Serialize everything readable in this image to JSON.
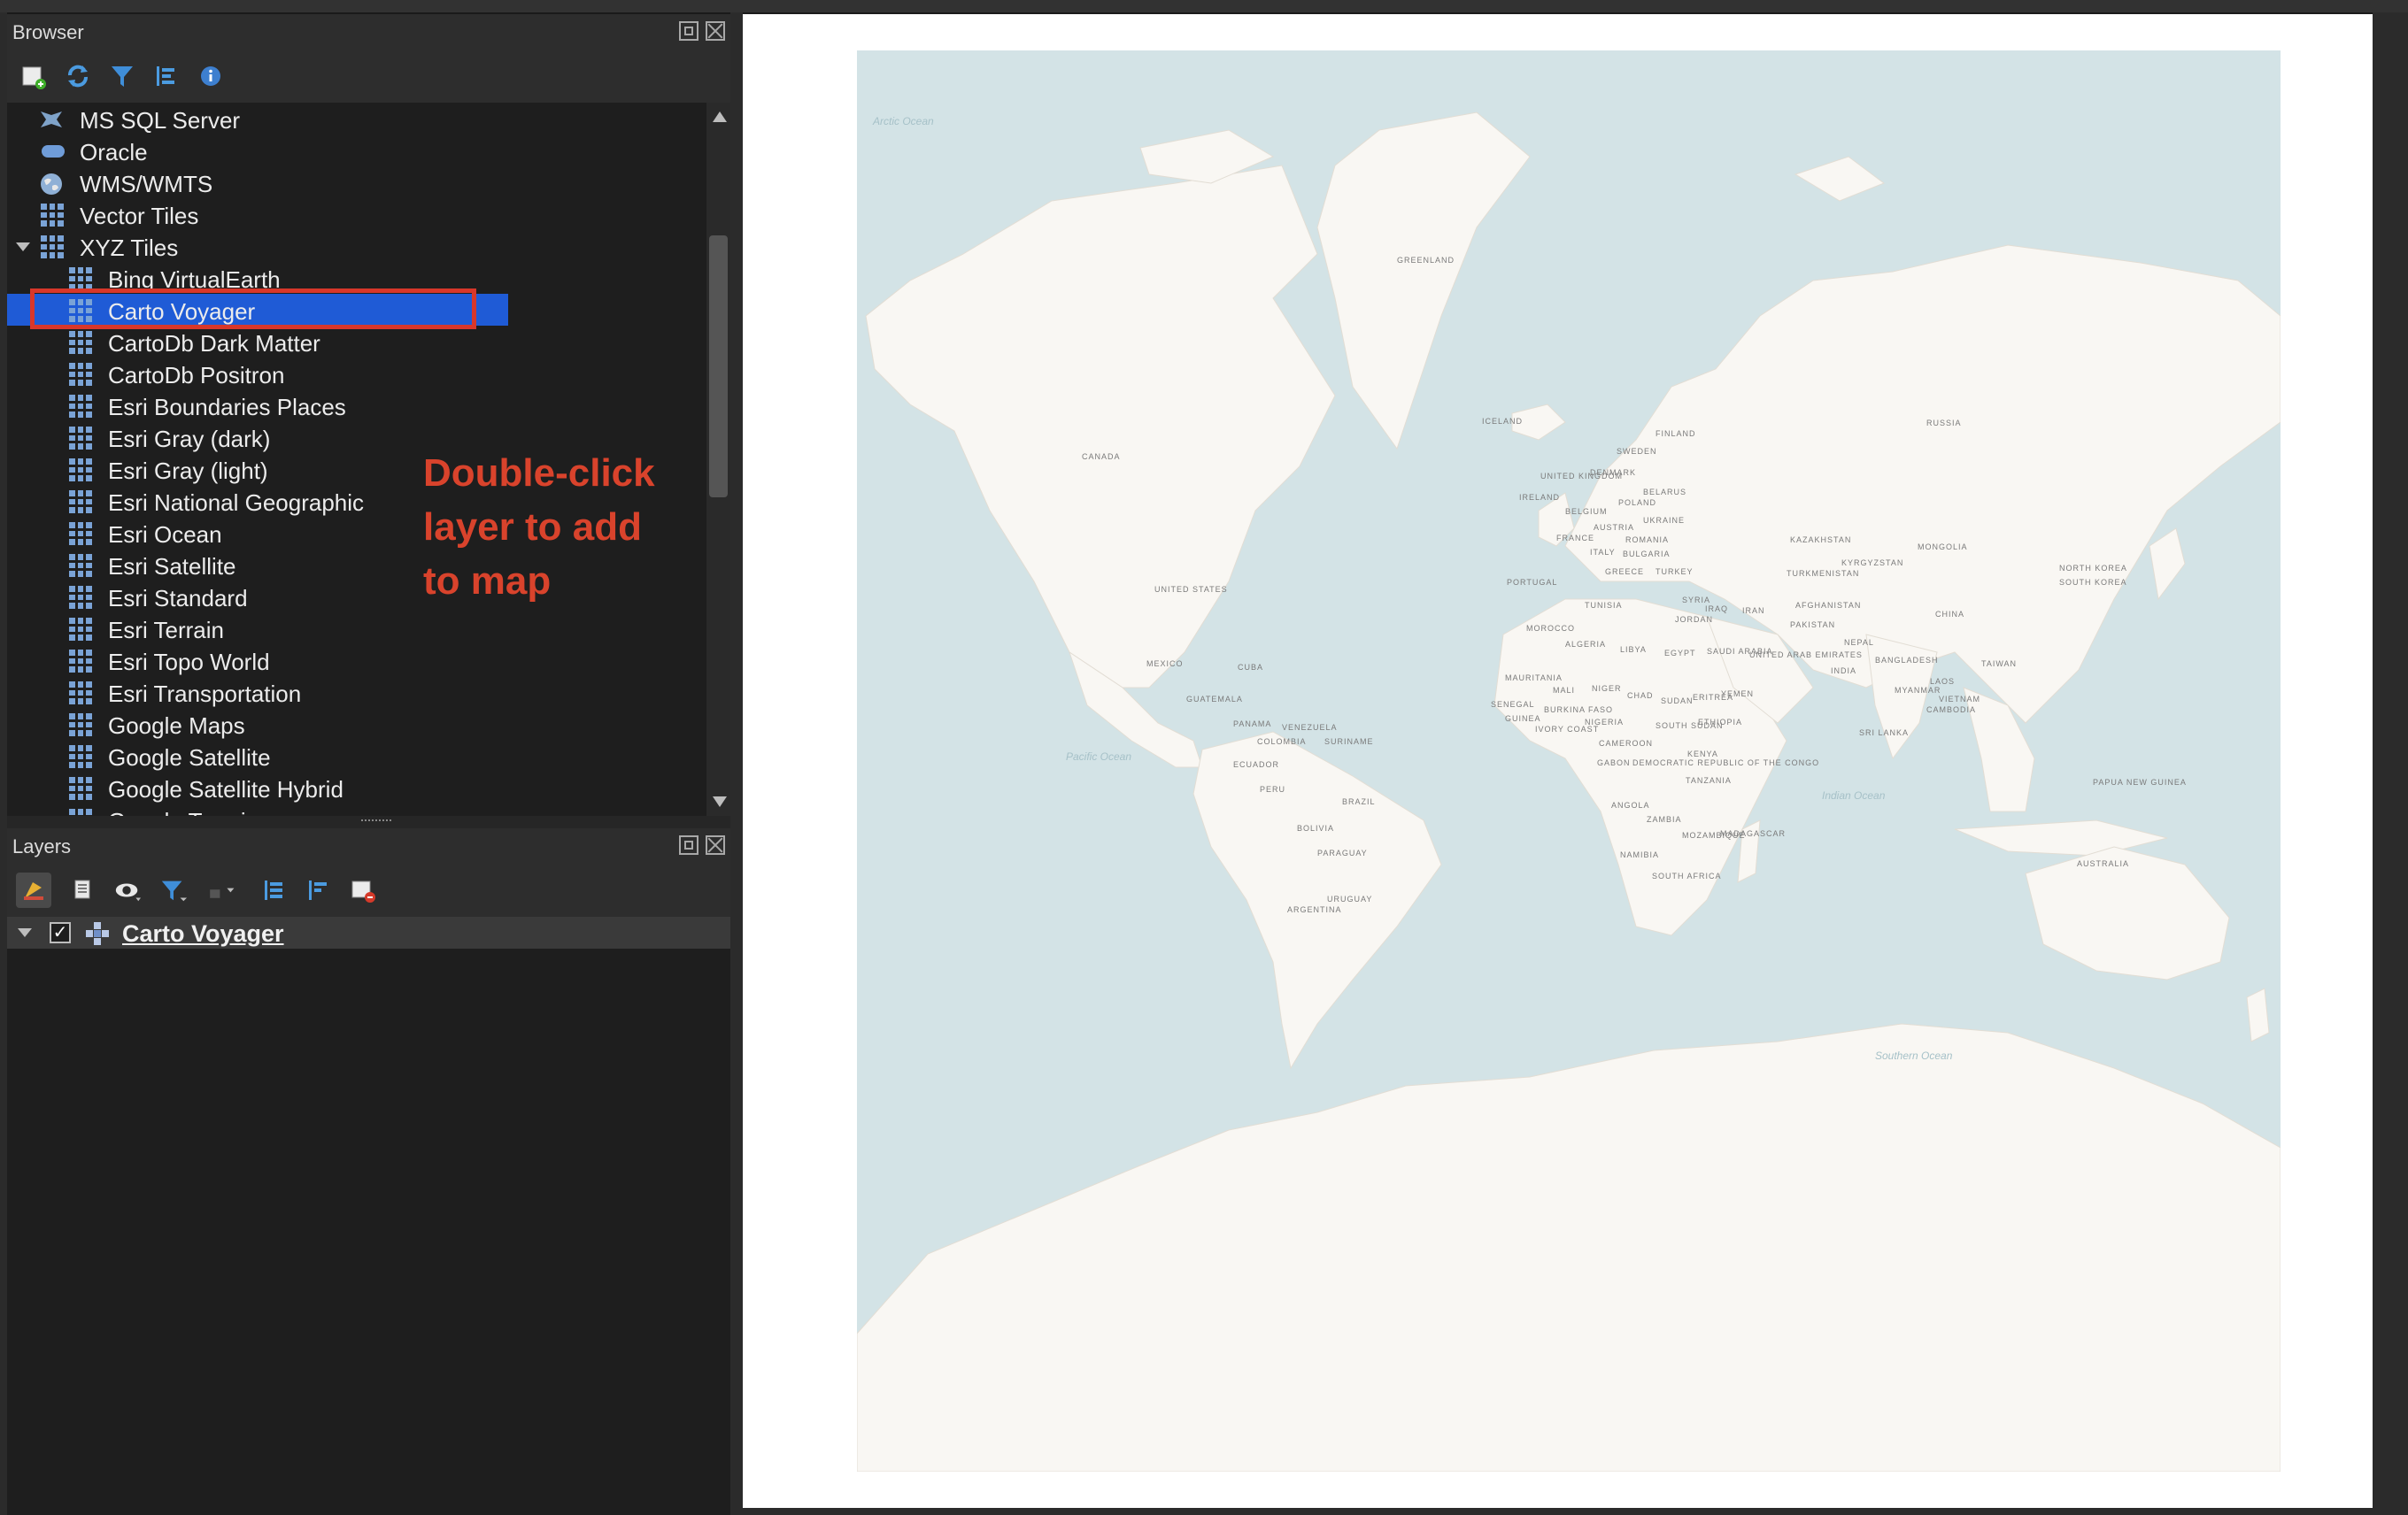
{
  "browser": {
    "title": "Browser",
    "toolbar": [
      "add-layer-icon",
      "refresh-icon",
      "filter-icon",
      "collapse-all-icon",
      "info-icon"
    ],
    "items": [
      {
        "label": "MS SQL Server",
        "icon": "mssql-icon"
      },
      {
        "label": "Oracle",
        "icon": "oracle-icon"
      },
      {
        "label": "WMS/WMTS",
        "icon": "wms-icon"
      },
      {
        "label": "Vector Tiles",
        "icon": "vector-tiles-icon"
      },
      {
        "label": "XYZ Tiles",
        "icon": "xyz-tiles-icon",
        "expanded": true
      },
      {
        "label": "Bing VirtualEarth",
        "icon": "xyz-layer-icon"
      },
      {
        "label": "Carto Voyager",
        "icon": "xyz-layer-icon",
        "selected": true
      },
      {
        "label": "CartoDb Dark Matter",
        "icon": "xyz-layer-icon"
      },
      {
        "label": "CartoDb Positron",
        "icon": "xyz-layer-icon"
      },
      {
        "label": "Esri Boundaries Places",
        "icon": "xyz-layer-icon"
      },
      {
        "label": "Esri Gray (dark)",
        "icon": "xyz-layer-icon"
      },
      {
        "label": "Esri Gray (light)",
        "icon": "xyz-layer-icon"
      },
      {
        "label": "Esri National Geographic",
        "icon": "xyz-layer-icon"
      },
      {
        "label": "Esri Ocean",
        "icon": "xyz-layer-icon"
      },
      {
        "label": "Esri Satellite",
        "icon": "xyz-layer-icon"
      },
      {
        "label": "Esri Standard",
        "icon": "xyz-layer-icon"
      },
      {
        "label": "Esri Terrain",
        "icon": "xyz-layer-icon"
      },
      {
        "label": "Esri Topo World",
        "icon": "xyz-layer-icon"
      },
      {
        "label": "Esri Transportation",
        "icon": "xyz-layer-icon"
      },
      {
        "label": "Google Maps",
        "icon": "xyz-layer-icon"
      },
      {
        "label": "Google Satellite",
        "icon": "xyz-layer-icon"
      },
      {
        "label": "Google Satellite Hybrid",
        "icon": "xyz-layer-icon"
      },
      {
        "label": "Google Terrain",
        "icon": "xyz-layer-icon"
      }
    ],
    "annotation": {
      "line1": "Double-click",
      "line2": "layer to add",
      "line3": "to map",
      "color": "#d9432c"
    }
  },
  "layers": {
    "title": "Layers",
    "toolbar": [
      "open-layer-styling-icon",
      "add-group-icon",
      "manage-visibility-icon",
      "filter-legend-icon",
      "filter-by-expression-icon",
      "expand-all-icon",
      "collapse-all-icon",
      "remove-layer-icon"
    ],
    "items": [
      {
        "label": "Carto Voyager",
        "checked": true,
        "checkmark": "✓"
      }
    ]
  },
  "map": {
    "ocean_color": "#d3e3e6",
    "land_color": "#f9f7f3",
    "labels": {
      "greenland": "GREENLAND",
      "iceland": "ICELAND",
      "canada": "CANADA",
      "united_states": "UNITED STATES",
      "mexico": "MEXICO",
      "cuba": "CUBA",
      "guatemala": "GUATEMALA",
      "panama": "PANAMA",
      "venezuela": "VENEZUELA",
      "colombia": "COLOMBIA",
      "suriname": "SURINAME",
      "ecuador": "ECUADOR",
      "peru": "PERU",
      "brazil": "BRAZIL",
      "bolivia": "BOLIVIA",
      "paraguay": "PARAGUAY",
      "uruguay": "URUGUAY",
      "argentina": "ARGENTINA",
      "russia": "RUSSIA",
      "finland": "FINLAND",
      "sweden": "SWEDEN",
      "denmark": "DENMARK",
      "united_kingdom": "UNITED KINGDOM",
      "ireland": "IRELAND",
      "belarus": "BELARUS",
      "poland": "POLAND",
      "belgium": "BELGIUM",
      "austria": "AUSTRIA",
      "ukraine": "UKRAINE",
      "france": "FRANCE",
      "romania": "ROMANIA",
      "portugal": "PORTUGAL",
      "italy": "ITALY",
      "bulgaria": "BULGARIA",
      "greece": "GREECE",
      "turkey": "TURKEY",
      "kazakhstan": "KAZAKHSTAN",
      "mongolia": "MONGOLIA",
      "turkmenistan": "TURKMENISTAN",
      "kyrgyzstan": "KYRGYZSTAN",
      "north_korea": "NORTH KOREA",
      "south_korea": "SOUTH KOREA",
      "tunisia": "TUNISIA",
      "syria": "SYRIA",
      "iraq": "IRAQ",
      "iran": "IRAN",
      "afghanistan": "AFGHANISTAN",
      "morocco": "MOROCCO",
      "jordan": "JORDAN",
      "pakistan": "PAKISTAN",
      "china": "CHINA",
      "algeria": "ALGERIA",
      "libya": "LIBYA",
      "egypt": "EGYPT",
      "saudi_arabia": "SAUDI ARABIA",
      "uae": "UNITED ARAB EMIRATES",
      "nepal": "NEPAL",
      "india": "INDIA",
      "bangladesh": "BANGLADESH",
      "taiwan": "TAIWAN",
      "mauritania": "MAURITANIA",
      "mali": "MALI",
      "niger": "NIGER",
      "chad": "CHAD",
      "sudan": "SUDAN",
      "eritrea": "ERITREA",
      "yemen": "YEMEN",
      "myanmar": "MYANMAR",
      "laos": "LAOS",
      "vietnam": "VIETNAM",
      "senegal": "SENEGAL",
      "guinea": "GUINEA",
      "burkina_faso": "BURKINA FASO",
      "nigeria": "NIGERIA",
      "ivory_coast": "IVORY COAST",
      "south_sudan": "SOUTH SUDAN",
      "ethiopia": "ETHIOPIA",
      "cambodia": "CAMBODIA",
      "sri_lanka": "SRI LANKA",
      "cameroon": "CAMEROON",
      "gabon": "GABON",
      "dr_congo": "DEMOCRATIC REPUBLIC OF THE CONGO",
      "kenya": "KENYA",
      "tanzania": "TANZANIA",
      "angola": "ANGOLA",
      "zambia": "ZAMBIA",
      "mozambique": "MOZAMBIQUE",
      "madagascar": "MADAGASCAR",
      "namibia": "NAMIBIA",
      "south_africa": "SOUTH AFRICA",
      "papua_new_guinea": "PAPUA NEW GUINEA",
      "australia": "AUSTRALIA",
      "arctic_ocean": "Arctic Ocean",
      "pacific_ocean": "Pacific Ocean",
      "indian_ocean": "Indian Ocean",
      "southern_ocean": "Southern Ocean"
    }
  }
}
